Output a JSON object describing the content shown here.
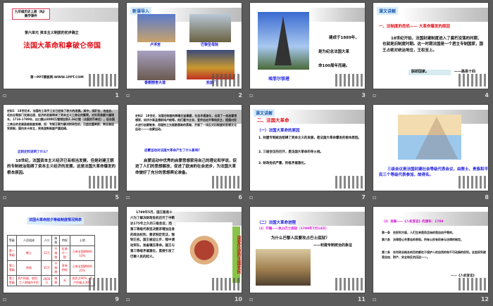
{
  "footer_icon": "slide-show-icon",
  "slides": [
    {
      "num": "1",
      "badge": [
        "九年级历史上册（RJ）",
        "教学课件"
      ],
      "unit": "第六单元 资本主义制度的初步确立",
      "title": "法国大革命和拿破仑帝国",
      "site": "第一PPT模板网-WWW.1PPT.COM"
    },
    {
      "num": "2",
      "tag": "新课导入",
      "captions": [
        "卢浮宫",
        "巴黎圣母院",
        "香榭丽舍大道",
        "凯旋门"
      ]
    },
    {
      "num": "3",
      "caption": "埃菲尔铁塔",
      "lines": [
        "建成于1889年，",
        "是为纪念法国大革",
        "命100周年而建。"
      ]
    },
    {
      "num": "4",
      "tag": "课文讲解",
      "heading": "一、旧制度的危机—— 大革命爆发的原因",
      "body": "18世纪开始，法国封建制度进入了腐朽没落的时期，也就是旧制度时期。这一时期法国是一个君主专制国家，国王占绝对统治地位，王权至上。",
      "quote": "朕即国家。",
      "quote_author": "——路易十四"
    },
    {
      "num": "5",
      "source": "史料1　18世纪末，法国的工场手工业已经有了较大的发展。其中，采矿业、冶金业、毛纺业等部门发展迅速，经济的发展带来了资本主义工商业的繁荣。对外贸易额大幅增长，1716-1789年，出口额从8000万锂增加到2.26亿锂（法国货币单位）。但法国工商业的发展面临制度束缚，如：专制王朝为解决财政危机，日益加重剥削，商业被迫受限制，国内关卡林立，贸易垄断制度严重阻碍。",
      "question": "这则史料说明了什么？",
      "answer": "18世纪，法国资本主义经济已有相当发展，但是封建王朝的专制统治阻碍了资本主义经济的发展，这是法国大革命爆发的根本原因。"
    },
    {
      "num": "6",
      "source": "史料2　18世纪，法国旧制度的弊端日益暴露，社会矛盾激化，出现了一批启蒙思想家，如伏尔泰孟德斯鸠卢梭等。他们著书立说，宣传自由平等和民主，提倡对民众进行启蒙教育，用理性之光驱散愚昧的黑暗，开展了一场反对旧制度的思想文化运动———启蒙运动。",
      "question": "启蒙运动对法国大革命产生了什么影响？",
      "answer": "启蒙运动中优秀的启蒙思想家用自己的理论和学说，促进了人们的思想解放，促进了欧洲的社会进步，为法国大革命做好了充分的思想舆论准备。"
    },
    {
      "num": "7",
      "tag": "课文讲解",
      "heading": "二、法国大革命",
      "sub": "（一）法国大革命的原因",
      "items": [
        "1. 封建专制统治阻碍了资本主义的发展，是法国大革命爆发的根本原因。",
        "2. 三级会议的召开，是法国大革命的导火线。",
        "3. 财政危机严重，阶级矛盾激化。"
      ]
    },
    {
      "num": "8",
      "caption": "三级会议是法国封建社会等级代表会议，由教士、贵族和平民三个等级代表参加，故得名。"
    },
    {
      "num": "9",
      "title": "法国大革命前夕等级制度情况简表",
      "headers": [
        "等级",
        "人员组成",
        "人口",
        "纳税",
        "特权",
        "土地"
      ],
      "rows": [
        [
          "第一等级",
          "教士",
          "12万",
          "不纳税",
          "征收什一税",
          "占有全国耕地的10%"
        ],
        [
          "第二等级",
          "贵族",
          "35万",
          "不纳税",
          "享有特权",
          "占有全国耕地的25%"
        ],
        [
          "第三等级",
          "资产阶级、农民、工人和城市平民",
          "2600万",
          "纳税",
          "无",
          "农民占90%，资产阶级占30%"
        ]
      ]
    },
    {
      "num": "10",
      "body": "1789年5月，国王路易十六为了解决财政危机召开了中断达175年之久的三级会议，而第三等级代表坚决要求增加自身的政治权利，要求制定宪法，限制王权。国王被迫让步，暗中调动军队，准备镇压革命。国王与第三等级矛盾激化，直接引发了巴黎人民的起义。",
      "side": "深受压迫的法国农民"
    },
    {
      "num": "11",
      "sub": "（二）法国大革命进程",
      "step": "（1）开端——攻占巴士底狱（1789年7月14日）",
      "question": "为什么巴黎人民要攻占巴士底狱？",
      "answer": "——封建专制统治的象征"
    },
    {
      "num": "12",
      "step": "（2）发展——《人权宣言》的颁布：1789",
      "articles": [
        "第一条　在权利方面，人们生来是而且始终是自由平等的。",
        "第六条　法律是公共意志的表现。所有公民有权参与法律的制定。",
        "第二条　任何政治结合的目的都在于保护人的自然的和不可动摇的权利。这些权利就是自由、财产、安全和反抗压迫——。"
      ],
      "source": "——《人权宣言》"
    }
  ]
}
